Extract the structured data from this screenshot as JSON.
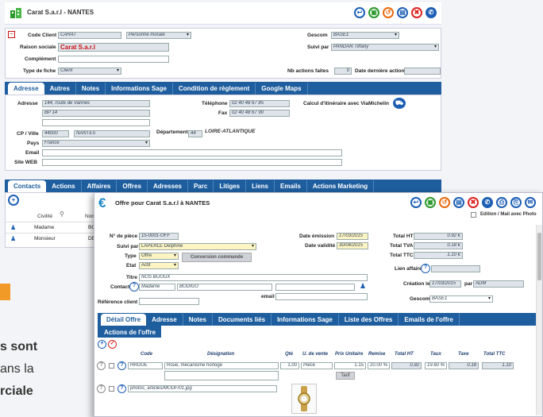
{
  "client": {
    "title": "Carat S.a.r.l - NANTES",
    "code_label": "Code Client",
    "code_value": "CARAT",
    "personne_value": "Personne morale",
    "raison_label": "Raison sociale",
    "raison_value": "Carat S.a.r.l",
    "complement_label": "Complément",
    "type_label": "Type de fiche",
    "type_value": "Client",
    "gescom_label": "Gescom",
    "gescom_value": "BASE1",
    "suivi_label": "Suivi par",
    "suivi_value": "PANDAN Tiffany",
    "nb_actions_label": "Nb actions faites",
    "nb_actions_value": "0",
    "date_action_label": "Date dernière action",
    "tabs": [
      "Adresse",
      "Autres",
      "Notes",
      "Informations Sage",
      "Condition de règlement",
      "Google Maps"
    ],
    "adresse_label": "Adresse",
    "adresse_line1": "144, route de Vannes",
    "adresse_line2": "BP 14",
    "telephone_label": "Téléphone",
    "telephone_value": "02 40 48 67 85",
    "fax_label": "Fax",
    "fax_value": "02 40 48 67 90",
    "itineraire_label": "Calcul d'itinéraire avec ViaMichelin",
    "cp_label": "CP / Ville",
    "cp_value": "44000",
    "ville_value": "NANTES",
    "departement_label": "Département",
    "departement_code": "44",
    "departement_name": "LOIRE-ATLANTIQUE",
    "pays_label": "Pays",
    "pays_value": "France",
    "email_label": "Email",
    "site_label": "Site WEB",
    "bottom_tabs": [
      "Contacts",
      "Actions",
      "Affaires",
      "Offres",
      "Adresses",
      "Parc",
      "Litiges",
      "Liens",
      "Emails",
      "Actions Marketing"
    ],
    "contacts_head_civilite": "Civilité",
    "contacts_head_nom": "Nom",
    "contacts": [
      {
        "civilite": "Madame",
        "nom": "BO"
      },
      {
        "civilite": "Monsieur",
        "nom": "DE"
      }
    ]
  },
  "bg_text": {
    "line1": "s sont",
    "line2": "ans la",
    "line3": "rciale"
  },
  "offer": {
    "title": "Offre pour Carat S.a.r.l à NANTES",
    "edition_label": "Edition / Mail avec Photo",
    "piece_label": "N° de pièce",
    "piece_value": "15-0001-OFF",
    "suivi_label": "Suivi par",
    "suivi_value": "LAPERLE Delphine",
    "type_label": "Type",
    "type_value": "Offre",
    "conversion_label": "Conversion commande",
    "etat_label": "Etat",
    "etat_value": "Actif",
    "emission_label": "Date émission",
    "emission_value": "17/03/2015",
    "validite_label": "Date validité",
    "validite_value": "30/04/2015",
    "total_ht_label": "Total HT",
    "total_ht_value": "0.92 €",
    "total_tva_label": "Total TVA",
    "total_tva_value": "0.18 €",
    "total_ttc_label": "Total TTC",
    "total_ttc_value": "1.10 €",
    "lien_label": "Lien affaire",
    "titre_label": "Titre",
    "titre_value": "NOS BIJOUX",
    "contact_label": "Contact",
    "contact_civ": "Madame",
    "contact_nom": "BODIGO",
    "email_label": "email",
    "ref_label": "Référence client",
    "creation_label": "Création le",
    "creation_value": "17/03/2015",
    "par_label": "par",
    "par_value": "ADM",
    "gescom_label": "Gescom",
    "gescom_value": "BASE1",
    "tabs": [
      "Détail Offre",
      "Adresse",
      "Notes",
      "Documents liés",
      "Informations Sage",
      "Liste des Offres",
      "Emails de l'offre"
    ],
    "tab_actions": "Actions de l'offre",
    "columns": [
      "Code",
      "Désignation",
      "Qté",
      "U. de vente",
      "Prix Unitaire",
      "Remise",
      "Total HT",
      "Taux",
      "Taxe",
      "Total TTC"
    ],
    "row": {
      "code": "HROUE",
      "designation": "Roue, mécanisme horloge",
      "qte": "1.00",
      "unite": "Pièce",
      "prix": "1.15",
      "remise": "20.00 %",
      "total_ht": "0.92",
      "taux": "19.60 %",
      "taxe": "0.18",
      "total_ttc": "1.10"
    },
    "tarif_label": "Tarif",
    "photo_path": "photos_articles/MODF/01.jpg"
  },
  "colors": {
    "tab_bar": "#1e5e9e",
    "accent_red": "#cc1111"
  }
}
